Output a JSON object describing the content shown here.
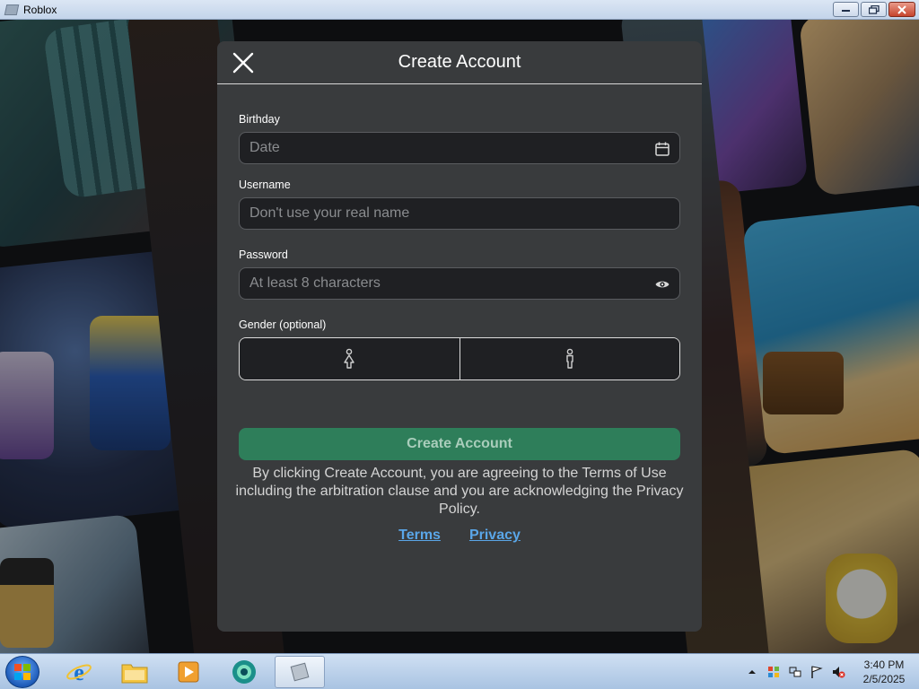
{
  "window": {
    "title": "Roblox",
    "controls": [
      "minimize",
      "maximize",
      "close"
    ]
  },
  "modal": {
    "title": "Create Account",
    "close_icon": "close-icon",
    "birthday": {
      "label": "Birthday",
      "placeholder": "Date",
      "icon": "calendar-icon"
    },
    "username": {
      "label": "Username",
      "placeholder": "Don't use your real name"
    },
    "password": {
      "label": "Password",
      "placeholder": "At least 8 characters",
      "icon": "eye-icon"
    },
    "gender": {
      "label": "Gender (optional)",
      "options": [
        "female-icon",
        "male-icon"
      ]
    },
    "create_button": "Create Account",
    "legal_text": "By clicking Create Account, you are agreeing to the Terms of Use including the arbitration clause and you are acknowledging the Privacy Policy.",
    "links": {
      "terms": "Terms",
      "privacy": "Privacy"
    }
  },
  "taskbar": {
    "apps": [
      "internet-explorer-icon",
      "file-explorer-icon",
      "media-player-icon",
      "browser-icon",
      "roblox-icon"
    ],
    "tray_icons": [
      "show-hidden-icons-icon",
      "windows-flag-icon",
      "network-icon",
      "action-center-flag-icon",
      "volume-muted-icon"
    ],
    "clock": {
      "time": "3:40 PM",
      "date": "2/5/2025"
    }
  },
  "colors": {
    "modal_bg": "#393b3d",
    "input_bg": "#1f2023",
    "primary_button": "#2e7e5a",
    "link": "#5aa6e8"
  }
}
